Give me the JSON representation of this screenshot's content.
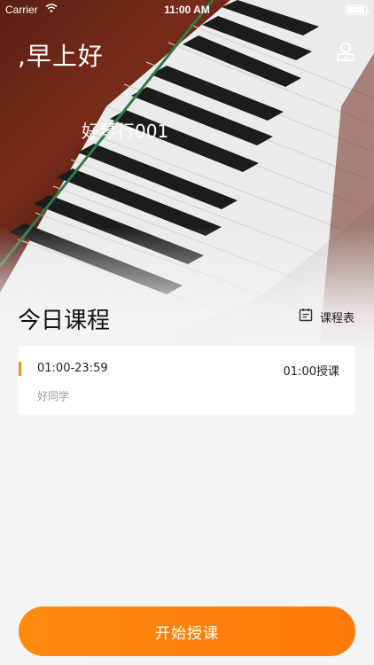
{
  "status_bar": {
    "carrier": "Carrier",
    "wifi_icon": "wifi-icon",
    "time": "11:00 AM",
    "battery_icon": "battery-icon"
  },
  "header": {
    "greeting": ",早上好",
    "studio_name": "好琴行001",
    "user_icon": "user-icon"
  },
  "today": {
    "title": "今日课程",
    "schedule_label": "课程表",
    "schedule_icon": "calendar-icon"
  },
  "lessons": [
    {
      "time_range": "01:00-23:59",
      "action": "01:00授课",
      "student": "好同学"
    }
  ],
  "footer": {
    "start_label": "开始授课"
  },
  "colors": {
    "accent": "#fd7a08",
    "background": "#f4f4f4",
    "card": "#ffffff"
  }
}
